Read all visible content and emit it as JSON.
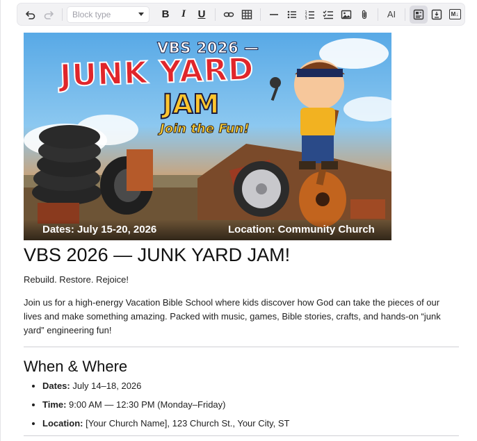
{
  "toolbar": {
    "block_type_placeholder": "Block type",
    "bold_label": "B",
    "italic_label": "I",
    "underline_label": "U",
    "ai_label": "AI",
    "markdown_label": "M↓"
  },
  "hero": {
    "kicker": "VBS 2026 —",
    "title_line1": "JUNK YARD",
    "title_line2": "JAM",
    "tagline": "Join the Fun!",
    "dates": "Dates: July 15-20, 2026",
    "location": "Location: Community Church"
  },
  "doc": {
    "title": "VBS 2026 — JUNK YARD JAM!",
    "tagline": "Rebuild. Restore. Rejoice!",
    "intro": "Join us for a high-energy Vacation Bible School where kids discover how God can take the pieces of our lives and make something amazing. Packed with music, games, Bible stories, crafts, and hands-on “junk yard” engineering fun!",
    "section_heading": "When & Where",
    "details": [
      {
        "label": "Dates:",
        "value": " July 14–18, 2026"
      },
      {
        "label": "Time:",
        "value": " 9:00 AM — 12:30 PM (Monday–Friday)"
      },
      {
        "label": "Location:",
        "value": " [Your Church Name], 123 Church St., Your City, ST"
      }
    ]
  },
  "colors": {
    "toolbar_bg": "#f2f2f4",
    "active_button": "#dcdce2",
    "title_red": "#e0262b",
    "title_yellow": "#ffc52d"
  }
}
